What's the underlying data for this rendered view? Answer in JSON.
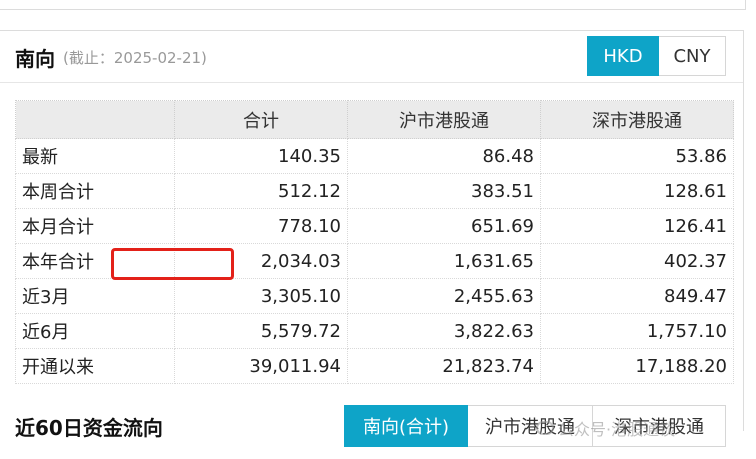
{
  "header": {
    "title": "南向",
    "date": "(截止：2025-02-21)"
  },
  "currency_toggle": {
    "hkd": "HKD",
    "cny": "CNY",
    "active": "HKD"
  },
  "table": {
    "columns": [
      "",
      "合计",
      "沪市港股通",
      "深市港股通"
    ],
    "rows": [
      {
        "label": "最新",
        "total": "140.35",
        "sh": "86.48",
        "sz": "53.86"
      },
      {
        "label": "本周合计",
        "total": "512.12",
        "sh": "383.51",
        "sz": "128.61"
      },
      {
        "label": "本月合计",
        "total": "778.10",
        "sh": "651.69",
        "sz": "126.41"
      },
      {
        "label": "本年合计",
        "total": "2,034.03",
        "sh": "1,631.65",
        "sz": "402.37"
      },
      {
        "label": "近3月",
        "total": "3,305.10",
        "sh": "2,455.63",
        "sz": "849.47"
      },
      {
        "label": "近6月",
        "total": "5,579.72",
        "sh": "3,822.63",
        "sz": "1,757.10"
      },
      {
        "label": "开通以来",
        "total": "39,011.94",
        "sh": "21,823.74",
        "sz": "17,188.20"
      }
    ]
  },
  "flow_section": {
    "title": "近60日资金流向",
    "tabs": [
      "南向(合计)",
      "沪市港股通",
      "深市港股通"
    ],
    "active_tab": "南向(合计)"
  },
  "watermark": "公众号·港股通谈",
  "colors": {
    "accent": "#0ea4c8",
    "highlight": "#e32119"
  }
}
